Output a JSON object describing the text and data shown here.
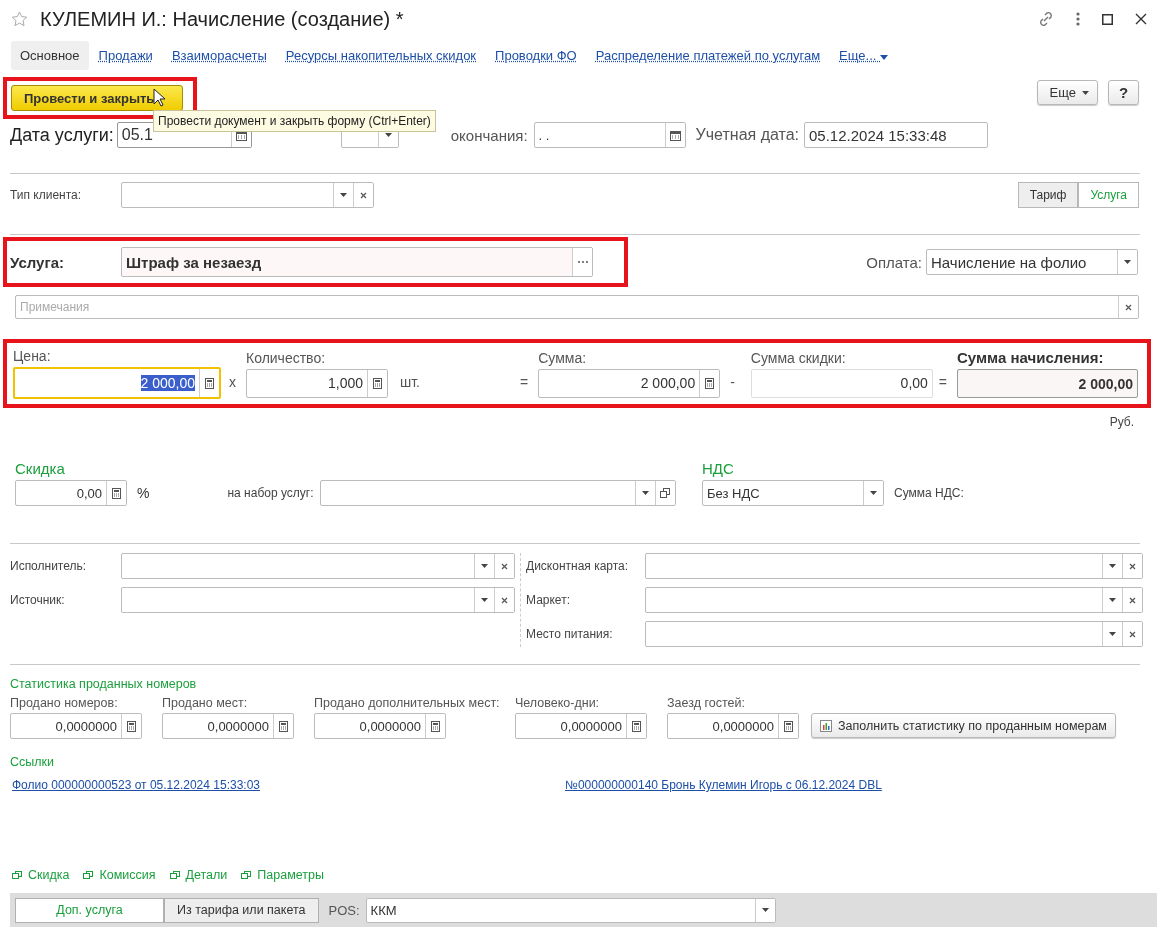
{
  "window": {
    "title": "КУЛЕМИН И.: Начисление (создание) *"
  },
  "tabs": [
    {
      "label": "Основное",
      "selected": true
    },
    {
      "label": "Продажи",
      "selected": false
    },
    {
      "label": "Взаиморасчеты",
      "selected": false
    },
    {
      "label": "Ресурсы накопительных скидок",
      "selected": false
    },
    {
      "label": "Проводки ФО",
      "selected": false
    },
    {
      "label": "Распределение платежей по услугам",
      "selected": false
    },
    {
      "label": "Еще...",
      "selected": false,
      "kind": "menu"
    }
  ],
  "toolbar": {
    "primary": "Провести и закрыть",
    "highlighted": true,
    "tooltip": "Провести документ и закрыть форму (Ctrl+Enter)",
    "more": "Еще",
    "help": "?"
  },
  "dates": {
    "service_date_label": "Дата услуги:",
    "service_date": "05.1",
    "end_label": "окончания:",
    "end_date": ". .",
    "account_label": "Учетная дата:",
    "account_date": "05.12.2024 15:33:48"
  },
  "client_type": {
    "label": "Тип клиента:"
  },
  "mode_switch": [
    {
      "label": "Тариф",
      "selected": false
    },
    {
      "label": "Услуга",
      "selected": true
    }
  ],
  "service": {
    "label": "Услуга:",
    "value": "Штраф за незаезд",
    "highlighted": true
  },
  "payment": {
    "label": "Оплата:",
    "value": "Начисление на фолио"
  },
  "notes": {
    "placeholder": "Примечания"
  },
  "amounts": {
    "highlighted": true,
    "price": {
      "label": "Цена:",
      "value": "2 000,00",
      "focused": true
    },
    "times": "x",
    "quantity": {
      "label": "Количество:",
      "value": "1,000"
    },
    "unit": "шт.",
    "eq1": "=",
    "sum": {
      "label": "Сумма:",
      "value": "2 000,00"
    },
    "minus": "-",
    "discount_sum": {
      "label": "Сумма скидки:",
      "value": "0,00"
    },
    "eq2": "=",
    "total": {
      "label": "Сумма начисления:",
      "value": "2 000,00"
    },
    "currency": "Руб."
  },
  "discount": {
    "title": "Скидка",
    "value": "0,00",
    "percent": "%",
    "set_label": "на набор услуг:"
  },
  "vat": {
    "title": "НДС",
    "value": "Без НДС",
    "sum_label": "Сумма НДС:"
  },
  "left_fields": [
    {
      "label": "Исполнитель:"
    },
    {
      "label": "Источник:"
    }
  ],
  "right_fields": [
    {
      "label": "Дисконтная карта:"
    },
    {
      "label": "Маркет:"
    },
    {
      "label": "Место питания:"
    }
  ],
  "stats": {
    "title": "Статистика проданных номеров",
    "fields": [
      {
        "label": "Продано номеров:",
        "value": "0,0000000"
      },
      {
        "label": "Продано мест:",
        "value": "0,0000000"
      },
      {
        "label": "Продано дополнительных мест:",
        "value": "0,0000000"
      },
      {
        "label": "Человеко-дни:",
        "value": "0,0000000"
      },
      {
        "label": "Заезд гостей:",
        "value": "0,0000000"
      }
    ],
    "fill_button": "Заполнить статистику по проданным номерам"
  },
  "links": {
    "title": "Ссылки",
    "items": [
      "Фолио 000000000523 от 05.12.2024 15:33:03",
      "№000000000140 Бронь Кулемин Игорь с 06.12.2024 DBL"
    ]
  },
  "sections": [
    "Скидка",
    "Комиссия",
    "Детали",
    "Параметры"
  ],
  "bottom": {
    "modes": [
      {
        "label": "Доп. услуга",
        "selected": true
      },
      {
        "label": "Из тарифа или пакета",
        "selected": false
      }
    ],
    "pos_label": "POS:",
    "pos_value": "ККМ"
  }
}
